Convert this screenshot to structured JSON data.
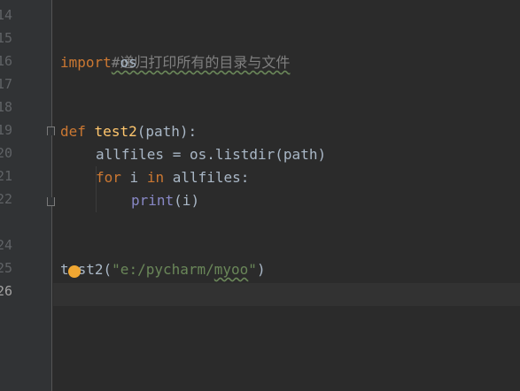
{
  "gutter": {
    "line_numbers": [
      "14",
      "15",
      "16",
      "17",
      "18",
      "19",
      "20",
      "21",
      "22",
      "24",
      "24",
      "25",
      "26"
    ],
    "current_line": "26"
  },
  "code": {
    "comment": "#递归打印所有的目录与文件",
    "import_kw": "import",
    "import_mod": "os",
    "def_kw": "def",
    "func_name": "test2",
    "func_params": "(path):",
    "line20": "allfiles = os.listdir(path)",
    "for_kw": "for",
    "for_var": " i ",
    "in_kw": "in",
    "for_iter": " allfiles:",
    "print_fn": "print",
    "print_args": "(i)",
    "call_name_a": "t",
    "call_name_b": "st2(",
    "call_str_a": "\"e:/pycharm/",
    "call_str_b": "myoo",
    "call_str_c": "\"",
    "call_close": ")"
  },
  "colors": {
    "background": "#2b2b2b",
    "gutter": "#313335",
    "keyword": "#cc7832",
    "function": "#ffc66d",
    "builtin": "#8888c6",
    "string": "#6a8759",
    "comment": "#808080",
    "default": "#a9b7c6",
    "intention_bulb": "#f0a732"
  },
  "icons": [
    "fold-open-icon",
    "fold-close-icon",
    "intention-bulb-icon"
  ]
}
